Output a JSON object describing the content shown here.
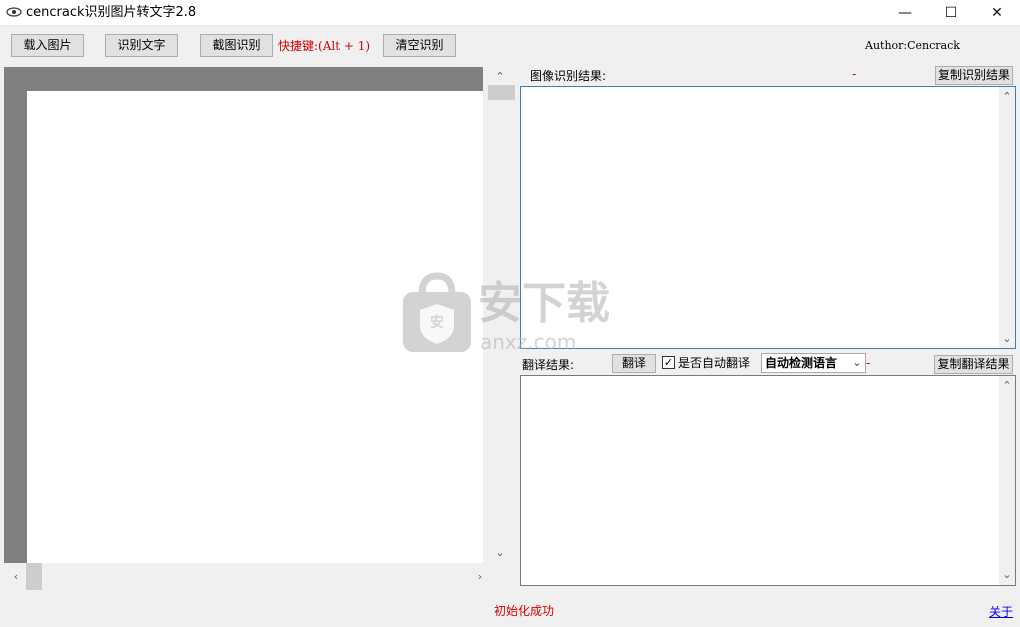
{
  "window": {
    "title": "cencrack识别图片转文字2.8",
    "icon": "eye-icon",
    "minimize": "—",
    "maximize": "☐",
    "close": "✕"
  },
  "toolbar": {
    "load_image": "载入图片",
    "recognize_text": "识别文字",
    "screenshot_recognize": "截图识别",
    "hotkey_label": "快捷键:(Alt + 1)",
    "clear": "清空识别",
    "author": "Author:Cencrack"
  },
  "ocr": {
    "label": "图像识别结果:",
    "dash": "-",
    "copy_button": "复制识别结果",
    "text": ""
  },
  "translate": {
    "label": "翻译结果:",
    "button": "翻译",
    "auto_label": "是否自动翻译",
    "auto_checked": true,
    "language": "自动检测语言",
    "dash": "-",
    "copy_button": "复制翻译结果",
    "text": ""
  },
  "status": {
    "message": "初始化成功",
    "about": "关于"
  },
  "watermark": {
    "title": "安下载",
    "domain": "anxz.com",
    "badge": "安"
  },
  "colors": {
    "accent_red": "#d40000",
    "link_blue": "#0000ee",
    "panel_gray": "#808080"
  }
}
